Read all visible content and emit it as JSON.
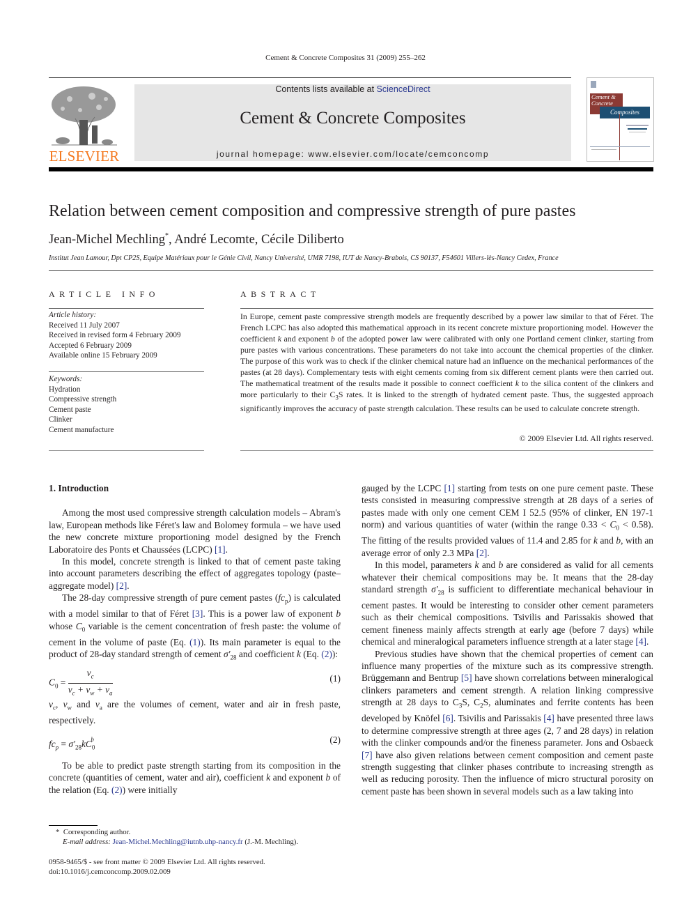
{
  "running_head": "Cement & Concrete Composites 31 (2009) 255–262",
  "publisher": {
    "name": "ELSEVIER",
    "brand_color": "#f47920"
  },
  "masthead": {
    "contents_prefix": "Contents lists available at ",
    "contents_link": "ScienceDirect",
    "journal_name": "Cement & Concrete Composites",
    "homepage_label": "journal homepage: ",
    "homepage_url": "www.elsevier.com/locate/cemconcomp",
    "background_color": "#e6e6e6"
  },
  "cover": {
    "title_line1": "Cement &",
    "title_line2": "Concrete",
    "title_line3": "Composites",
    "red_color": "#8c3a34",
    "blue_color": "#1d4f73"
  },
  "article": {
    "title": "Relation between cement composition and compressive strength of pure pastes",
    "authors": [
      {
        "name": "Jean-Michel Mechling",
        "mark": "*"
      },
      {
        "name": "André Lecomte"
      },
      {
        "name": "Cécile Diliberto"
      }
    ],
    "author_sep": ", ",
    "affiliation": "Institut Jean Lamour, Dpt CP2S, Equipe Matériaux pour le Génie Civil, Nancy Université, UMR 7198, IUT de Nancy-Brabois, CS 90137, F54601 Villers-lès-Nancy Cedex, France"
  },
  "article_info": {
    "heading": "ARTICLE INFO",
    "history_label": "Article history:",
    "history": [
      "Received 11 July 2007",
      "Received in revised form 4 February 2009",
      "Accepted 6 February 2009",
      "Available online 15 February 2009"
    ],
    "keywords_label": "Keywords:",
    "keywords": [
      "Hydration",
      "Compressive strength",
      "Cement paste",
      "Clinker",
      "Cement manufacture"
    ]
  },
  "abstract": {
    "heading": "ABSTRACT",
    "text_1": "In Europe, cement paste compressive strength models are frequently described by a power law similar to that of Féret. The French LCPC has also adopted this mathematical approach in its recent concrete mixture proportioning model. However the coefficient ",
    "k": "k",
    "text_2": " and exponent ",
    "b": "b",
    "text_3": " of the adopted power law were calibrated with only one Portland cement clinker, starting from pure pastes with various concentrations. These parameters do not take into account the chemical properties of the clinker. The purpose of this work was to check if the clinker chemical nature had an influence on the mechanical performances of the pastes (at 28 days). Complementary tests with eight cements coming from six different cement plants were then carried out. The mathematical treatment of the results made it possible to connect coefficient ",
    "text_4": " to the silica content of the clinkers and more particularly to their C",
    "sub3": "3",
    "text_5": "S rates. It is linked to the strength of hydrated cement paste. Thus, the suggested approach significantly improves the accuracy of paste strength calculation. These results can be used to calculate concrete strength.",
    "copyright": "© 2009 Elsevier Ltd. All rights reserved."
  },
  "body": {
    "section_heading": "1. Introduction",
    "p1": "Among the most used compressive strength calculation models – Abram's law, European methods like Féret's law and Bolomey formula – we have used the new concrete mixture proportioning model designed by the French Laboratoire des Ponts et Chaussées (LCPC) ",
    "p2": "In this model, concrete strength is linked to that of cement paste taking into account parameters describing the effect of aggregates topology (paste–aggregate model) ",
    "p3a": "The 28-day compressive strength of pure cement pastes (",
    "p3b": ") is calculated with a model similar to that of Féret ",
    "p3c": ". This is a power law of exponent ",
    "p3d": " whose ",
    "p3e": " variable is the cement concentration of fresh paste: the volume of cement in the volume of paste (Eq. ",
    "p3f": "). Its main parameter is equal to the product of 28-day standard strength of cement ",
    "p3g": " and coefficient ",
    "p3h": " (Eq. ",
    "p3i": "):",
    "eq1_label": "(1)",
    "eq2_label": "(2)",
    "eq_note": " are the volumes of cement, water and air in fresh paste, respectively.",
    "eq_note_and": " and ",
    "p4a": "To be able to predict paste strength starting from its composition in the concrete (quantities of cement, water and air), coefficient ",
    "p4b": " and exponent ",
    "p4c": " of the relation (Eq. ",
    "p4d": ") were initially gauged by the LCPC ",
    "p4e": " starting from tests on one pure cement paste. These tests consisted in measuring compressive strength at 28 days of a series of pastes made with only one cement CEM I 52.5 (95% of clinker, EN 197-1 norm) and various quantities of water (within the range 0.33 < ",
    "p4f": " < 0.58). The fitting of the results provided values of 11.4 and 2.85 for ",
    "p4g": ", with an average error of only 2.3 MPa ",
    "p5a": "In this model, parameters ",
    "p5b": " are considered as valid for all cements whatever their chemical compositions may be. It means that the 28-day standard strength ",
    "p5c": " is sufficient to differentiate mechanical behaviour in cement pastes. It would be interesting to consider other cement parameters such as their chemical compositions. Tsivilis and Parissakis showed that cement fineness mainly affects strength at early age (before 7 days) while chemical and mineralogical parameters influence strength at a later stage ",
    "p6a": "Previous studies have shown that the chemical properties of cement can influence many properties of the mixture such as its compressive strength. Brüggemann and Bentrup ",
    "p6b": " have shown correlations between mineralogical clinkers parameters and cement strength. A relation linking compressive strength at 28 days to C",
    "p6c": "S, C",
    "p6d": "S, aluminates and ferrite contents has been developed by Knöfel ",
    "p6e": ". Tsivilis and Parissakis ",
    "p6f": " have presented three laws to determine compressive strength at three ages (2, 7 and 28 days) in relation with the clinker compounds and/or the fineness parameter. Jons and Osbaeck ",
    "p6g": " have also given relations between cement composition and cement paste strength suggesting that clinker phases contribute to increasing strength as well as reducing porosity. Then the influence of micro structural porosity on cement paste has been shown in several models such as a law taking into",
    "refs": {
      "r1": "[1]",
      "r2": "[2]",
      "r3": "[3]",
      "r4": "[4]",
      "r5": "[5]",
      "r6": "[6]",
      "r7": "[7]",
      "eq1": "(1)",
      "eq2": "(2)"
    },
    "sym": {
      "k": "k",
      "b": "b",
      "and": " and ",
      "period": "."
    }
  },
  "footnote": {
    "mark": "*",
    "corresponding": "Corresponding author.",
    "email_label": "E-mail address:",
    "email": "Jean-Michel.Mechling@iutnb.uhp-nancy.fr",
    "email_suffix": " (J.-M. Mechling)."
  },
  "front_matter": {
    "issn_line": "0958-9465/$ - see front matter © 2009 Elsevier Ltd. All rights reserved.",
    "doi": "doi:10.1016/j.cemconcomp.2009.02.009"
  },
  "link_color": "#2b3990"
}
